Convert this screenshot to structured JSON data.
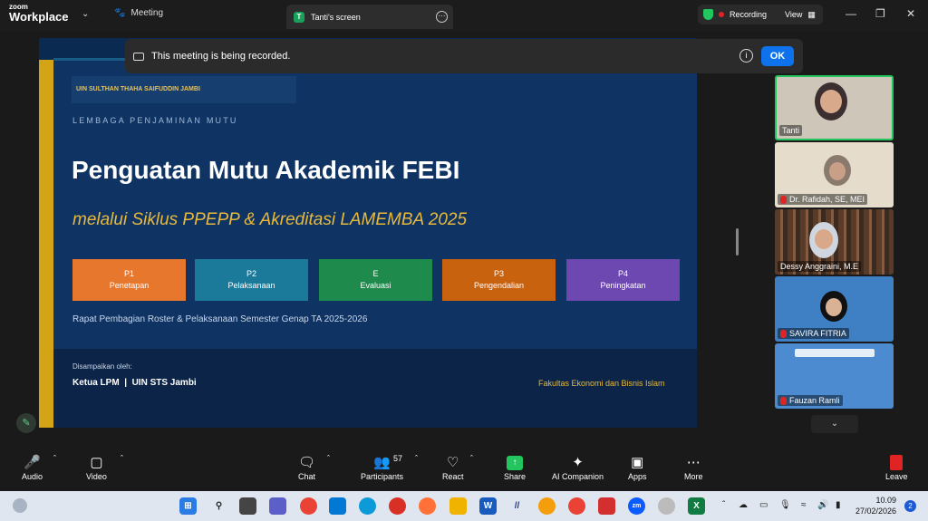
{
  "app": {
    "brand_small": "zoom",
    "brand_big": "Workplace"
  },
  "tabs": {
    "meeting": "Meeting",
    "screen": "Tanti's screen",
    "screen_badge": "T"
  },
  "recording": {
    "label": "Recording",
    "view": "View"
  },
  "banner": {
    "text": "This meeting is being recorded.",
    "ok": "OK"
  },
  "slide": {
    "university": "UIN SULTHAN THAHA SAIFUDDIN JAMBI",
    "unit": "LEMBAGA PENJAMINAN MUTU",
    "title": "Penguatan Mutu Akademik FEBI",
    "subtitle": "melalui Siklus PPEPP & Akreditasi LAMEMBA 2025",
    "steps": [
      {
        "code": "P1",
        "label": "Penetapan",
        "color": "#e8772e"
      },
      {
        "code": "P2",
        "label": "Pelaksanaan",
        "color": "#1b7a9a"
      },
      {
        "code": "E",
        "label": "Evaluasi",
        "color": "#1e8a4c"
      },
      {
        "code": "P3",
        "label": "Pengendalian",
        "color": "#c9620e"
      },
      {
        "code": "P4",
        "label": "Peningkatan",
        "color": "#6c48b0"
      }
    ],
    "meeting_desc": "Rapat Pembagian Roster & Pelaksanaan Semester Genap TA 2025-2026",
    "presented_by": "Disampaikan oleh:",
    "presenter": "Ketua LPM  |  UIN STS Jambi",
    "faculty": "Fakultas Ekonomi dan Bisnis Islam"
  },
  "participants_panel": [
    {
      "name": "Tanti",
      "muted": false
    },
    {
      "name": "Dr. Rafidah, SE, MEI",
      "muted": true
    },
    {
      "name": "Dessy Anggraini, M.E",
      "muted": false
    },
    {
      "name": "SAVIRA FITRIA",
      "muted": true
    },
    {
      "name": "Fauzan Ramli",
      "muted": true
    }
  ],
  "toolbar": {
    "audio": "Audio",
    "video": "Video",
    "chat": "Chat",
    "participants": "Participants",
    "participants_count": "57",
    "react": "React",
    "share": "Share",
    "ai": "AI Companion",
    "apps": "Apps",
    "more": "More",
    "leave": "Leave"
  },
  "taskbar": {
    "time": "10.09",
    "date": "27/02/2026",
    "notifications": "2"
  },
  "colors": {
    "accent": "#0e72ed",
    "active_speaker": "#22c55e",
    "recording": "#e02424"
  }
}
